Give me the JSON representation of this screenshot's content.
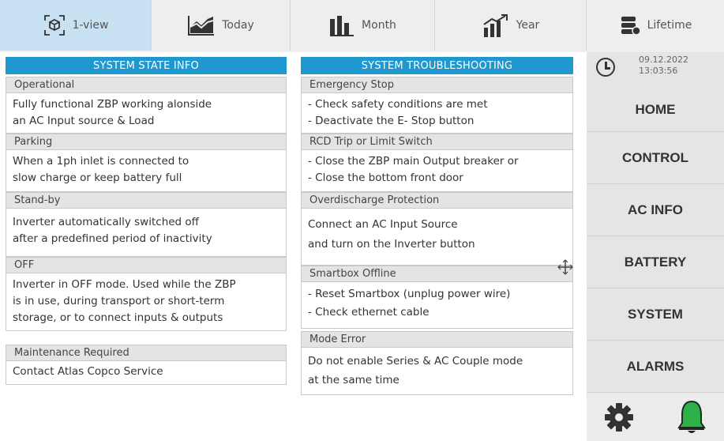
{
  "tabs": [
    {
      "label": "1-view",
      "icon": "cube-arrows-icon",
      "active": true
    },
    {
      "label": "Today",
      "icon": "area-chart-icon",
      "active": false
    },
    {
      "label": "Month",
      "icon": "bar-chart-icon",
      "active": false
    },
    {
      "label": "Year",
      "icon": "trend-up-icon",
      "active": false
    },
    {
      "label": "Lifetime",
      "icon": "stack-icon",
      "active": false
    }
  ],
  "state_panel": {
    "title": "SYSTEM STATE INFO",
    "sections": [
      {
        "title": "Operational",
        "lines": [
          "Fully functional ZBP working alonside",
          "an AC Input source & Load"
        ]
      },
      {
        "title": "Parking",
        "lines": [
          "When a 1ph inlet is connected to",
          "slow charge or keep battery full"
        ]
      },
      {
        "title": "Stand-by",
        "lines": [
          "Inverter automatically switched off",
          "after a predefined period of inactivity"
        ]
      },
      {
        "title": "OFF",
        "lines": [
          "Inverter in OFF mode. Used while the ZBP",
          "is in use, during transport or short-term",
          "storage, or to connect inputs & outputs"
        ]
      },
      {
        "title": "Maintenance Required",
        "lines": [
          "Contact Atlas Copco Service"
        ]
      }
    ]
  },
  "troubleshooting_panel": {
    "title": "SYSTEM TROUBLESHOOTING",
    "sections": [
      {
        "title": "Emergency Stop",
        "lines": [
          "- Check safety conditions are met",
          "- Deactivate the E- Stop button"
        ]
      },
      {
        "title": "RCD Trip or Limit Switch",
        "lines": [
          "- Close the ZBP main Output breaker or",
          "- Close the bottom front door"
        ]
      },
      {
        "title": "Overdischarge Protection",
        "lines": [
          "Connect an AC Input Source",
          "and turn on the Inverter button"
        ]
      },
      {
        "title": "Smartbox Offline",
        "lines": [
          "- Reset Smartbox (unplug power wire)",
          "- Check ethernet cable"
        ]
      },
      {
        "title": "Mode Error",
        "lines": [
          "Do not enable Series & AC Couple mode",
          "at the same time"
        ]
      }
    ]
  },
  "clock": {
    "date": "09.12.2022",
    "time": "13:03:56"
  },
  "nav": [
    "HOME",
    "CONTROL",
    "AC INFO",
    "BATTERY",
    "SYSTEM",
    "ALARMS"
  ],
  "bottom_icons": [
    "gear-icon",
    "bell-icon"
  ],
  "colors": {
    "accent": "#1f97cf",
    "active_tab": "#c8e1f3",
    "bell": "#2db24a"
  }
}
